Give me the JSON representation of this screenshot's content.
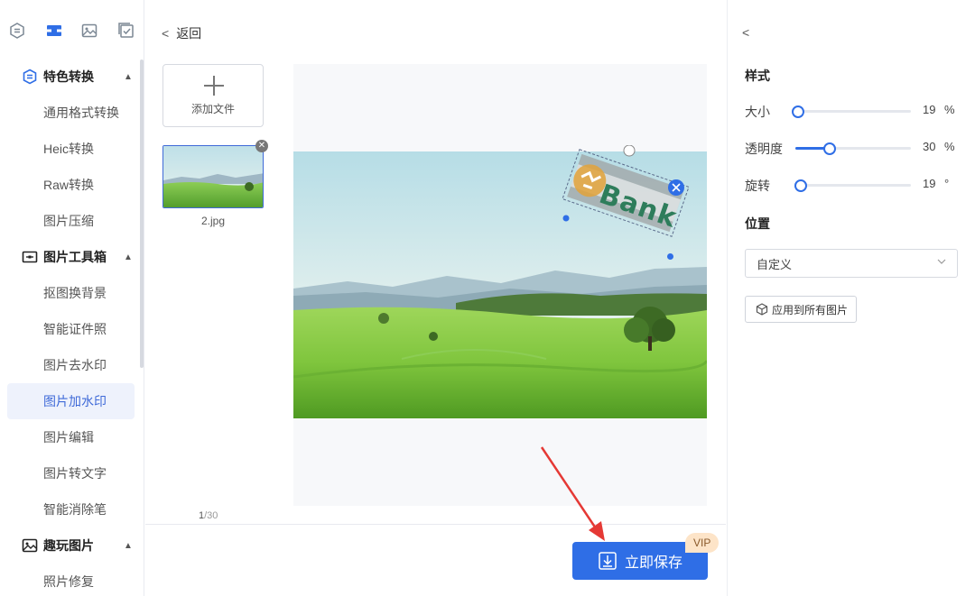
{
  "sidebar": {
    "top_icons": [
      "format-convert-icon",
      "toolbox-icon",
      "image-icon",
      "checklist-icon"
    ],
    "groups": [
      {
        "label": "特色转换",
        "icon": "convert-circle-icon",
        "items": [
          {
            "label": "通用格式转换"
          },
          {
            "label": "Heic转换"
          },
          {
            "label": "Raw转换"
          },
          {
            "label": "图片压缩"
          }
        ]
      },
      {
        "label": "图片工具箱",
        "icon": "toolbox-icon",
        "items": [
          {
            "label": "抠图换背景"
          },
          {
            "label": "智能证件照"
          },
          {
            "label": "图片去水印"
          },
          {
            "label": "图片加水印"
          },
          {
            "label": "图片编辑"
          },
          {
            "label": "图片转文字"
          },
          {
            "label": "智能消除笔"
          }
        ]
      },
      {
        "label": "趣玩图片",
        "icon": "image-icon",
        "items": [
          {
            "label": "照片修复"
          }
        ]
      }
    ],
    "active_item": "图片加水印"
  },
  "main": {
    "back_label": "返回",
    "add_file_label": "添加文件",
    "file": {
      "name": "2.jpg"
    },
    "pager": {
      "current": "1",
      "total": "/30"
    },
    "watermark_text": "Bank",
    "save_label": "立即保存",
    "vip_label": "VIP"
  },
  "panel": {
    "style_title": "样式",
    "sliders": [
      {
        "label": "大小",
        "value": "19",
        "unit": "%",
        "fraction": 0.02
      },
      {
        "label": "透明度",
        "value": "30",
        "unit": "%",
        "fraction": 0.3
      },
      {
        "label": "旋转",
        "value": "19",
        "unit": "°",
        "fraction": 0.05
      }
    ],
    "position_title": "位置",
    "position_value": "自定义",
    "apply_all_label": "应用到所有图片"
  },
  "colors": {
    "accent": "#2f6ee6",
    "active_bg": "#eef2fc",
    "active_text": "#3f6ad8",
    "vip_bg": "#fde4c8",
    "annotation_arrow": "#e53935"
  }
}
